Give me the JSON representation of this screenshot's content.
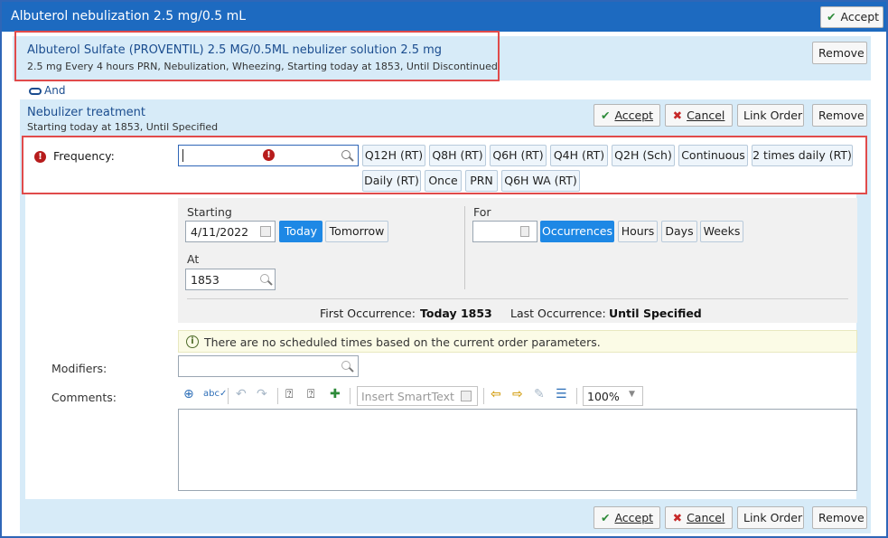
{
  "window": {
    "title": "Albuterol nebulization 2.5 mg/0.5 mL",
    "accept_label": "Accept"
  },
  "linked_order": {
    "name": "Albuterol Sulfate (PROVENTIL) 2.5 MG/0.5ML nebulizer solution 2.5 mg",
    "sig": "2.5 mg Every 4 hours PRN, Nebulization, Wheezing, Starting today at 1853, Until Discontinued",
    "remove_label": "Remove"
  },
  "and_label": "And",
  "nebulizer": {
    "title": "Nebulizer treatment",
    "subtitle": "Starting today at 1853, Until Specified",
    "buttons": {
      "accept": "Accept",
      "cancel": "Cancel",
      "link_order": "Link Order",
      "remove": "Remove"
    }
  },
  "frequency": {
    "label": "Frequency:",
    "value": "",
    "options": [
      "Q12H (RT)",
      "Q8H (RT)",
      "Q6H (RT)",
      "Q4H (RT)",
      "Q2H (Sch)",
      "Continuous",
      "2 times daily (RT)",
      "Daily (RT)",
      "Once",
      "PRN",
      "Q6H WA (RT)"
    ]
  },
  "schedule": {
    "starting_label": "Starting",
    "starting_value": "4/11/2022",
    "today_label": "Today",
    "tomorrow_label": "Tomorrow",
    "at_label": "At",
    "at_value": "1853",
    "for_label": "For",
    "for_value": "",
    "units": [
      "Occurrences",
      "Hours",
      "Days",
      "Weeks"
    ],
    "selected_unit": "Occurrences",
    "first_occurrence_label": "First Occurrence:",
    "first_occurrence_value": "Today 1853",
    "last_occurrence_label": "Last Occurrence:",
    "last_occurrence_value": "Until Specified"
  },
  "info_message": "There are no scheduled times based on the current order parameters.",
  "modifiers": {
    "label": "Modifiers:",
    "value": ""
  },
  "comments": {
    "label": "Comments:",
    "smarttext_placeholder": "Insert SmartText",
    "zoom": "100%",
    "value": ""
  },
  "footer_buttons": {
    "accept": "Accept",
    "cancel": "Cancel",
    "link_order": "Link Order",
    "remove": "Remove"
  },
  "colors": {
    "title_bar": "#1d6ac0",
    "band": "#d7ebf8",
    "selected": "#1e88e5",
    "error": "#b71c1c",
    "highlight_box": "#e04b4b"
  }
}
